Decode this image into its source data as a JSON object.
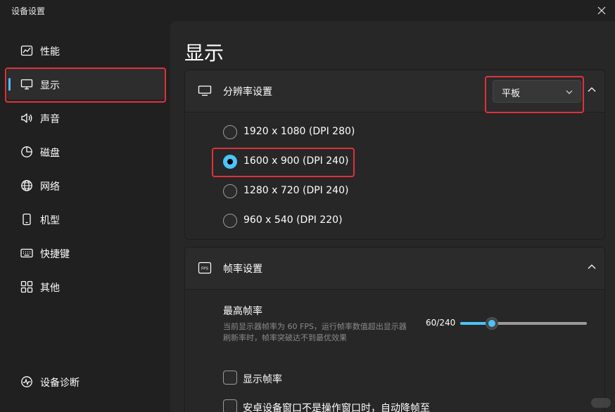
{
  "window": {
    "title": "设备设置"
  },
  "sidebar": {
    "items": [
      {
        "label": "性能",
        "icon": "performance-chart-icon"
      },
      {
        "label": "显示",
        "icon": "monitor-icon"
      },
      {
        "label": "声音",
        "icon": "speaker-icon"
      },
      {
        "label": "磁盘",
        "icon": "disk-pie-icon"
      },
      {
        "label": "网络",
        "icon": "globe-icon"
      },
      {
        "label": "机型",
        "icon": "phone-icon"
      },
      {
        "label": "快捷键",
        "icon": "keyboard-icon"
      },
      {
        "label": "其他",
        "icon": "grid-icon"
      }
    ],
    "active_item": "显示",
    "footer": {
      "label": "设备诊断",
      "icon": "diagnostics-icon"
    }
  },
  "main": {
    "title": "显示",
    "resolution": {
      "label": "分辨率设置",
      "device_type": "平板",
      "options": [
        "1920 x 1080 (DPI 280)",
        "1600 x 900 (DPI 240)",
        "1280 x 720 (DPI 240)",
        "960 x 540 (DPI 220)"
      ],
      "selected": "1600 x 900 (DPI 240)"
    },
    "fps": {
      "label": "帧率设置",
      "icon_text": "FPS",
      "max_label": "最高帧率",
      "description": "当前显示器帧率为 60 FPS，运行帧率数值超出显示器刷新率时，帧率突破达不到最优效果",
      "value_text": "60/240",
      "value": 60,
      "max": 240,
      "show_fps_label": "显示帧率",
      "auto_reduce_label": "安卓设备窗口不是操作窗口时，自动降帧至"
    }
  },
  "colors": {
    "accent": "#4cc2ff",
    "highlight": "#e0313c"
  }
}
